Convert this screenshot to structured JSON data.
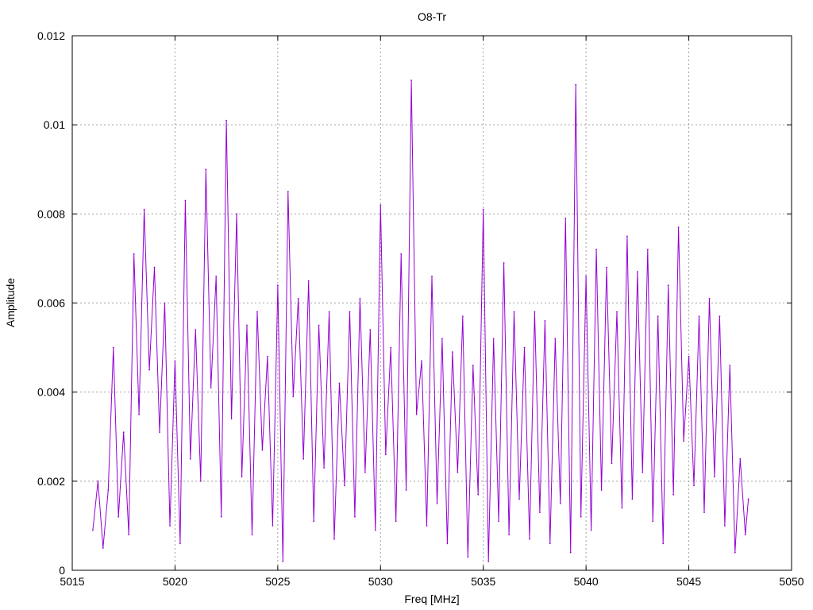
{
  "chart_data": {
    "type": "line",
    "title": "O8-Tr",
    "xlabel": "Freq [MHz]",
    "ylabel": "Amplitude",
    "xlim": [
      5015,
      5050
    ],
    "ylim": [
      0,
      0.012
    ],
    "xticks": [
      "5015",
      "5020",
      "5025",
      "5030",
      "5035",
      "5040",
      "5045",
      "5050"
    ],
    "yticks": [
      "0",
      "0.002",
      "0.004",
      "0.006",
      "0.008",
      "0.01",
      "0.012"
    ],
    "grid": true,
    "legend": "none",
    "series": [
      {
        "color": "#9400d3",
        "x": [
          5016.0,
          5016.25,
          5016.5,
          5016.75,
          5017.0,
          5017.25,
          5017.5,
          5017.75,
          5018.0,
          5018.25,
          5018.5,
          5018.75,
          5019.0,
          5019.25,
          5019.5,
          5019.75,
          5020.0,
          5020.25,
          5020.5,
          5020.75,
          5021.0,
          5021.25,
          5021.5,
          5021.75,
          5022.0,
          5022.25,
          5022.5,
          5022.75,
          5023.0,
          5023.25,
          5023.5,
          5023.75,
          5024.0,
          5024.25,
          5024.5,
          5024.75,
          5025.0,
          5025.25,
          5025.5,
          5025.75,
          5026.0,
          5026.25,
          5026.5,
          5026.75,
          5027.0,
          5027.25,
          5027.5,
          5027.75,
          5028.0,
          5028.25,
          5028.5,
          5028.75,
          5029.0,
          5029.25,
          5029.5,
          5029.75,
          5030.0,
          5030.25,
          5030.5,
          5030.75,
          5031.0,
          5031.25,
          5031.5,
          5031.75,
          5032.0,
          5032.25,
          5032.5,
          5032.75,
          5033.0,
          5033.25,
          5033.5,
          5033.75,
          5034.0,
          5034.25,
          5034.5,
          5034.75,
          5035.0,
          5035.25,
          5035.5,
          5035.75,
          5036.0,
          5036.25,
          5036.5,
          5036.75,
          5037.0,
          5037.25,
          5037.5,
          5037.75,
          5038.0,
          5038.25,
          5038.5,
          5038.75,
          5039.0,
          5039.25,
          5039.5,
          5039.75,
          5040.0,
          5040.25,
          5040.5,
          5040.75,
          5041.0,
          5041.25,
          5041.5,
          5041.75,
          5042.0,
          5042.25,
          5042.5,
          5042.75,
          5043.0,
          5043.25,
          5043.5,
          5043.75,
          5044.0,
          5044.25,
          5044.5,
          5044.75,
          5045.0,
          5045.25,
          5045.5,
          5045.75,
          5046.0,
          5046.25,
          5046.5,
          5046.75,
          5047.0,
          5047.25,
          5047.5,
          5047.75,
          5047.9
        ],
        "y": [
          0.0009,
          0.002,
          0.0005,
          0.0018,
          0.005,
          0.0012,
          0.0031,
          0.0008,
          0.0071,
          0.0035,
          0.0081,
          0.0045,
          0.0068,
          0.0031,
          0.006,
          0.001,
          0.0047,
          0.0006,
          0.0083,
          0.0025,
          0.0054,
          0.002,
          0.009,
          0.0041,
          0.0066,
          0.0012,
          0.0101,
          0.0034,
          0.008,
          0.0021,
          0.0055,
          0.0008,
          0.0058,
          0.0027,
          0.0048,
          0.001,
          0.0064,
          0.0002,
          0.0085,
          0.0039,
          0.0061,
          0.0025,
          0.0065,
          0.0011,
          0.0055,
          0.0023,
          0.0058,
          0.0007,
          0.0042,
          0.0019,
          0.0058,
          0.0012,
          0.0061,
          0.0022,
          0.0054,
          0.0009,
          0.0082,
          0.0026,
          0.005,
          0.0011,
          0.0071,
          0.0018,
          0.011,
          0.0035,
          0.0047,
          0.001,
          0.0066,
          0.0015,
          0.0052,
          0.0006,
          0.0049,
          0.0022,
          0.0057,
          0.0003,
          0.0046,
          0.0017,
          0.0081,
          0.0002,
          0.0052,
          0.0011,
          0.0069,
          0.0008,
          0.0058,
          0.0016,
          0.005,
          0.0007,
          0.0058,
          0.0013,
          0.0056,
          0.0006,
          0.0052,
          0.0015,
          0.0079,
          0.0004,
          0.0109,
          0.0012,
          0.0066,
          0.0009,
          0.0072,
          0.0018,
          0.0068,
          0.0024,
          0.0058,
          0.0014,
          0.0075,
          0.0016,
          0.0067,
          0.0022,
          0.0072,
          0.0011,
          0.0057,
          0.0006,
          0.0064,
          0.0017,
          0.0077,
          0.0029,
          0.0048,
          0.0019,
          0.0057,
          0.0013,
          0.0061,
          0.0021,
          0.0057,
          0.001,
          0.0046,
          0.0004,
          0.0025,
          0.0008,
          0.0016
        ]
      }
    ]
  }
}
